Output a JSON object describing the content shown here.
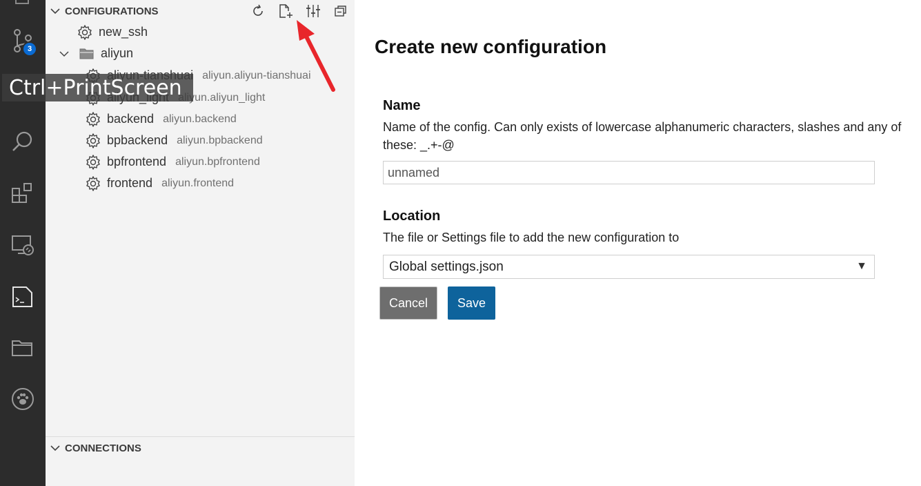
{
  "activity_bar": {
    "source_control_badge": "3",
    "items": [
      "source-control-icon",
      "search-icon",
      "extensions-icon",
      "remote-explorer-icon",
      "terminal-icon",
      "folder-icon",
      "paw-icon"
    ]
  },
  "tooltip": "Ctrl+PrintScreen",
  "sidebar": {
    "configurations_header": "CONFIGURATIONS",
    "connections_header": "CONNECTIONS",
    "toolbar": [
      "refresh-icon",
      "new-file-icon",
      "settings-sliders-icon",
      "collapse-all-icon"
    ],
    "tree": [
      {
        "label": "new_ssh",
        "desc": "",
        "type": "config"
      },
      {
        "label": "aliyun",
        "desc": "",
        "type": "folder"
      },
      {
        "label": "aliyun-tianshuai",
        "desc": "aliyun.aliyun-tianshuai",
        "type": "config"
      },
      {
        "label": "aliyun_light",
        "desc": "aliyun.aliyun_light",
        "type": "config"
      },
      {
        "label": "backend",
        "desc": "aliyun.backend",
        "type": "config"
      },
      {
        "label": "bpbackend",
        "desc": "aliyun.bpbackend",
        "type": "config"
      },
      {
        "label": "bpfrontend",
        "desc": "aliyun.bpfrontend",
        "type": "config"
      },
      {
        "label": "frontend",
        "desc": "aliyun.frontend",
        "type": "config"
      }
    ]
  },
  "form": {
    "title": "Create new configuration",
    "name": {
      "label": "Name",
      "description": "Name of the config. Can only exists of lowercase alphanumeric characters, slashes and any of these: _.+-@",
      "value": "unnamed"
    },
    "location": {
      "label": "Location",
      "description": "The file or Settings file to add the new configuration to",
      "selected": "Global settings.json"
    },
    "cancel_label": "Cancel",
    "save_label": "Save"
  },
  "colors": {
    "activity_bar": "#2c2c2c",
    "sidebar": "#f3f3f3",
    "save_button": "#0e639c",
    "cancel_button": "#6e6e6e",
    "badge": "#0a6bd3",
    "annotation_arrow": "#e8262b"
  }
}
